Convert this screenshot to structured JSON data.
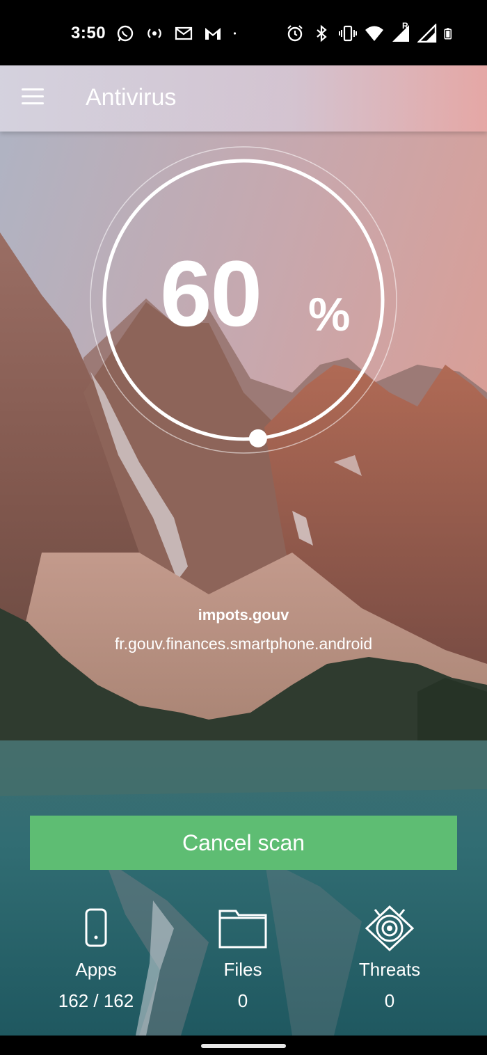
{
  "status_bar": {
    "time": "3:50",
    "left_icons": [
      "whatsapp-icon",
      "broadcast-icon",
      "mail-icon",
      "gmail-icon",
      "dot-icon"
    ],
    "right_icons": [
      "alarm-icon",
      "bluetooth-icon",
      "vibrate-icon",
      "wifi-icon",
      "signal-roaming-icon",
      "signal-icon",
      "battery-icon"
    ],
    "roaming_mark": "R"
  },
  "app_bar": {
    "title": "Antivirus",
    "menu_icon": "menu-icon"
  },
  "progress": {
    "value": "60",
    "unit": "%",
    "fraction": 0.6
  },
  "scan": {
    "app_name": "impots.gouv",
    "package": "fr.gouv.finances.smartphone.android"
  },
  "actions": {
    "cancel_label": "Cancel scan",
    "button_color": "#5ebd73"
  },
  "stats": [
    {
      "icon": "phone-icon",
      "label": "Apps",
      "value": "162 / 162"
    },
    {
      "icon": "folder-icon",
      "label": "Files",
      "value": "0"
    },
    {
      "icon": "threat-target-icon",
      "label": "Threats",
      "value": "0"
    }
  ]
}
